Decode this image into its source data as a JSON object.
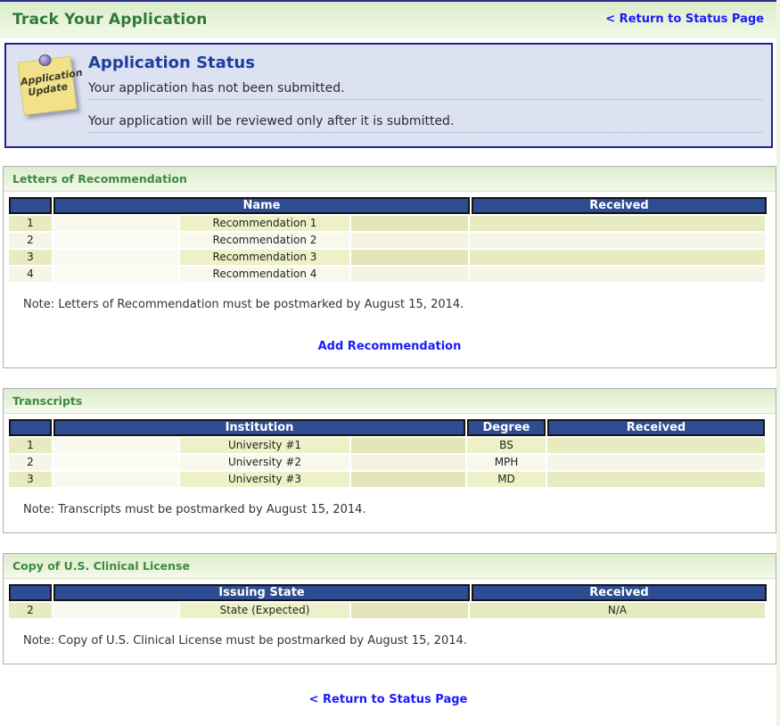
{
  "page": {
    "title": "Track Your Application",
    "return_link": "< Return to Status Page",
    "footer_link": "< Return to Status Page"
  },
  "status_box": {
    "sticky_note": {
      "line1": "Application",
      "line2": "Update"
    },
    "heading": "Application Status",
    "messages": [
      "Your application has not been submitted.",
      "Your application will be reviewed only after it is submitted."
    ]
  },
  "sections": [
    {
      "title": "Letters of Recommendation",
      "columns": [
        "Name",
        "Received"
      ],
      "rows": [
        {
          "num": "1",
          "value": "Recommendation 1",
          "received": ""
        },
        {
          "num": "2",
          "value": "Recommendation 2",
          "received": ""
        },
        {
          "num": "3",
          "value": "Recommendation 3",
          "received": ""
        },
        {
          "num": "4",
          "value": "Recommendation 4",
          "received": ""
        }
      ],
      "note": "Note: Letters of Recommendation must be postmarked by August 15, 2014.",
      "action_link": "Add Recommendation"
    },
    {
      "title": "Transcripts",
      "columns": [
        "Institution",
        "Degree",
        "Received"
      ],
      "rows": [
        {
          "num": "1",
          "value": "University #1",
          "degree": "BS",
          "received": ""
        },
        {
          "num": "2",
          "value": "University #2",
          "degree": "MPH",
          "received": ""
        },
        {
          "num": "3",
          "value": "University #3",
          "degree": "MD",
          "received": ""
        }
      ],
      "note": "Note: Transcripts must be postmarked by August 15, 2014."
    },
    {
      "title": "Copy of U.S. Clinical License",
      "columns": [
        "Issuing State",
        "Received"
      ],
      "rows": [
        {
          "num": "2",
          "value": "State (Expected)",
          "received": "N/A"
        }
      ],
      "note": "Note: Copy of U.S. Clinical License must be postmarked by August 15, 2014."
    }
  ],
  "colors": {
    "accent_green": "#2f7a33",
    "section_title_green": "#3c8a40",
    "link_blue": "#1a1aff",
    "table_header_navy": "#2e4c92",
    "status_box_bg": "#dde2f2",
    "status_border_navy": "#22228e",
    "status_heading_navy": "#1e3d9e",
    "row_odd": "#e8eabf",
    "row_even": "#f5f6e7",
    "sticky_note_yellow": "#f1e289"
  }
}
